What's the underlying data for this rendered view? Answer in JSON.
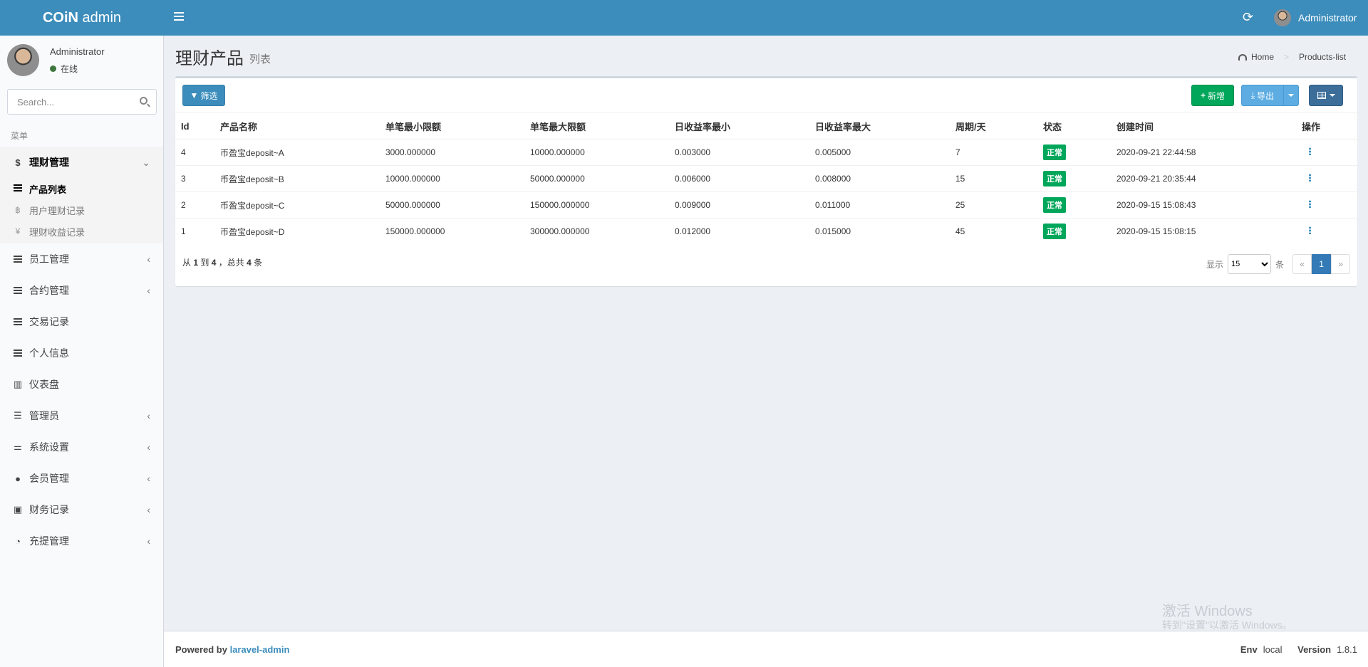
{
  "app": {
    "logo_bold": "COiN",
    "logo_rest": " admin"
  },
  "header": {
    "user_name": "Administrator"
  },
  "sidebar": {
    "user_name": "Administrator",
    "user_status": "在线",
    "search_placeholder": "Search...",
    "menu_header": "菜单",
    "items": [
      {
        "label": "理财管理",
        "icon": "dollar-icon",
        "has_children": true,
        "open": true
      },
      {
        "label": "员工管理",
        "icon": "bars-icon",
        "has_children": true
      },
      {
        "label": "合约管理",
        "icon": "bars-icon",
        "has_children": true
      },
      {
        "label": "交易记录",
        "icon": "bars-icon",
        "has_children": false
      },
      {
        "label": "个人信息",
        "icon": "bars-icon",
        "has_children": false
      },
      {
        "label": "仪表盘",
        "icon": "bar-chart-icon",
        "has_children": false
      },
      {
        "label": "管理员",
        "icon": "tasks-icon",
        "has_children": true
      },
      {
        "label": "系统设置",
        "icon": "sliders-icon",
        "has_children": true
      },
      {
        "label": "会员管理",
        "icon": "users-icon",
        "has_children": true
      },
      {
        "label": "财务记录",
        "icon": "money-icon",
        "has_children": true
      },
      {
        "label": "充提管理",
        "icon": "tachometer-icon",
        "has_children": true
      }
    ],
    "subitems": [
      {
        "label": "产品列表",
        "icon": "bars-icon",
        "active": true
      },
      {
        "label": "用户理财记录",
        "icon": "bitcoin-icon",
        "active": false
      },
      {
        "label": "理财收益记录",
        "icon": "yen-icon",
        "active": false
      }
    ]
  },
  "content": {
    "title": "理财产品",
    "subtitle": "列表",
    "breadcrumb": [
      "Home",
      "Products-list"
    ]
  },
  "toolbar": {
    "filter_label": "筛选",
    "new_label": "新增",
    "export_label": "导出"
  },
  "table": {
    "headers": [
      "Id",
      "产品名称",
      "单笔最小限额",
      "单笔最大限额",
      "日收益率最小",
      "日收益率最大",
      "周期/天",
      "状态",
      "创建时间",
      "操作"
    ],
    "rows": [
      [
        "4",
        "币盈宝deposit~A",
        "3000.000000",
        "10000.000000",
        "0.003000",
        "0.005000",
        "7",
        "正常",
        "2020-09-21 22:44:58"
      ],
      [
        "3",
        "币盈宝deposit~B",
        "10000.000000",
        "50000.000000",
        "0.006000",
        "0.008000",
        "15",
        "正常",
        "2020-09-21 20:35:44"
      ],
      [
        "2",
        "币盈宝deposit~C",
        "50000.000000",
        "150000.000000",
        "0.009000",
        "0.011000",
        "25",
        "正常",
        "2020-09-15 15:08:43"
      ],
      [
        "1",
        "币盈宝deposit~D",
        "150000.000000",
        "300000.000000",
        "0.012000",
        "0.015000",
        "45",
        "正常",
        "2020-09-15 15:08:15"
      ]
    ]
  },
  "summary": {
    "from_label": "从",
    "from": "1",
    "to_label": "到",
    "to": "4",
    "total_label": "，总共",
    "total": "4",
    "unit": "条"
  },
  "pagination": {
    "show_label": "显示",
    "per_page": "15",
    "unit": "条",
    "prev": "«",
    "current": "1",
    "next": "»"
  },
  "watermark": {
    "line1": "激活 Windows",
    "line2": "转到\"设置\"以激活 Windows。"
  },
  "footer": {
    "powered_by": "Powered by",
    "link": "laravel-admin",
    "env_label": "Env",
    "env": "local",
    "version_label": "Version",
    "version": "1.8.1"
  },
  "colors": {
    "header": "#3c8dbc",
    "success": "#00a65a",
    "sidebar_bg": "#f9fafc",
    "content_bg": "#ecf0f5"
  }
}
